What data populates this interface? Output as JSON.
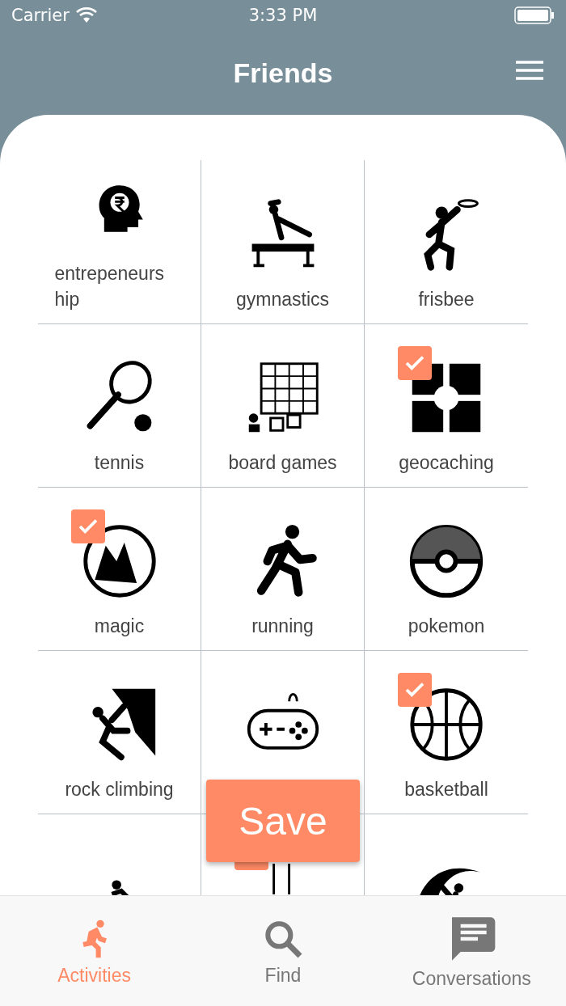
{
  "status_bar": {
    "carrier": "Carrier",
    "time": "3:33 PM"
  },
  "header": {
    "title": "Friends"
  },
  "activities": [
    {
      "label": "entrepeneurs hip",
      "checked": false
    },
    {
      "label": "gymnastics",
      "checked": false
    },
    {
      "label": "frisbee",
      "checked": false
    },
    {
      "label": "tennis",
      "checked": false
    },
    {
      "label": "board games",
      "checked": false
    },
    {
      "label": "geocaching",
      "checked": true
    },
    {
      "label": "magic",
      "checked": true
    },
    {
      "label": "running",
      "checked": false
    },
    {
      "label": "pokemon",
      "checked": false
    },
    {
      "label": "rock climbing",
      "checked": false
    },
    {
      "checked": false
    },
    {
      "label": "basketball",
      "checked": true
    },
    {
      "checked": false
    },
    {
      "checked": true
    },
    {
      "checked": false
    }
  ],
  "save_button": {
    "label": "Save"
  },
  "tab_bar": [
    {
      "label": "Activities",
      "selected": true
    },
    {
      "label": "Find",
      "selected": false
    },
    {
      "label": "Conversations",
      "selected": false
    }
  ]
}
